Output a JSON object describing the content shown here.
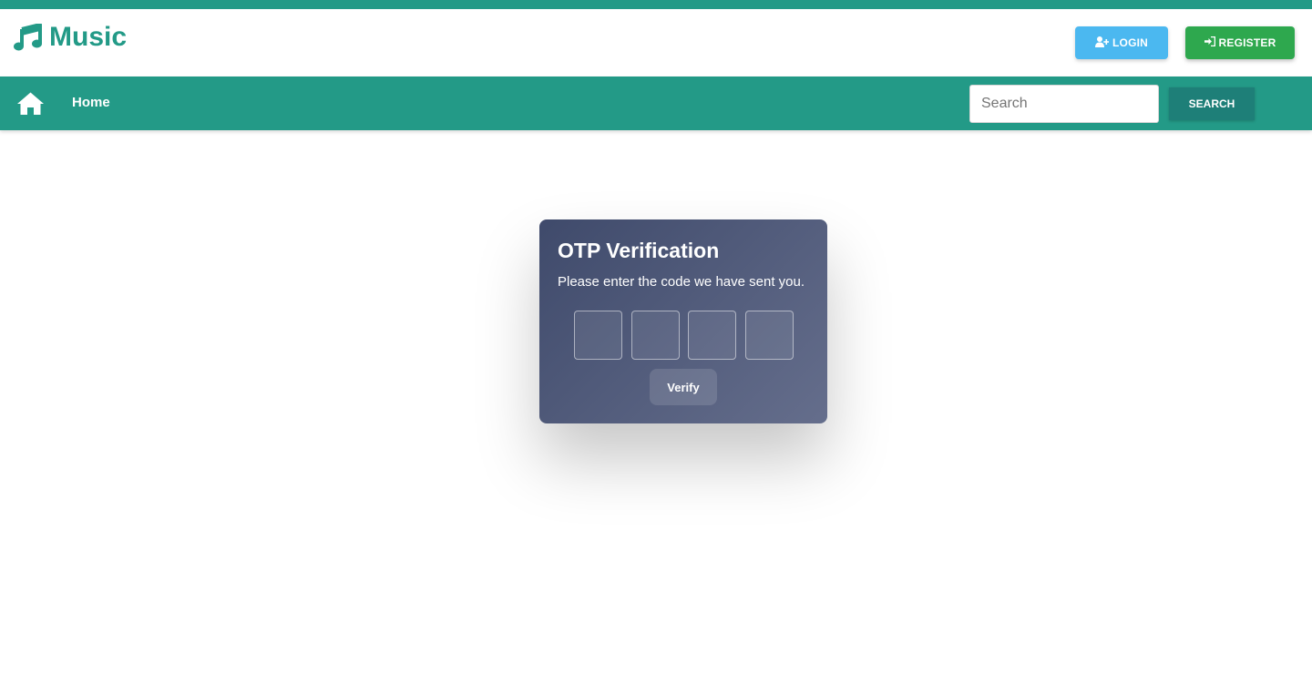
{
  "header": {
    "brand_name": "Music",
    "brand_icon": "music-note-icon",
    "login_label": "LOGIN",
    "login_icon": "user-plus-icon",
    "register_label": "REGISTER",
    "register_icon": "sign-in-icon"
  },
  "navbar": {
    "home_icon": "home-icon",
    "home_label": "Home",
    "search_placeholder": "Search",
    "search_value": "",
    "search_button_label": "SEARCH"
  },
  "otp": {
    "title": "OTP Verification",
    "subtitle": "Please enter the code we have sent you.",
    "digits": [
      "",
      "",
      "",
      ""
    ],
    "verify_label": "Verify"
  },
  "colors": {
    "primary": "#239a87",
    "login": "#4bb8f0",
    "register": "#2ea84e",
    "search_button": "#1e7f78",
    "card_start": "#3f4a6b",
    "card_end": "#656e8c"
  }
}
